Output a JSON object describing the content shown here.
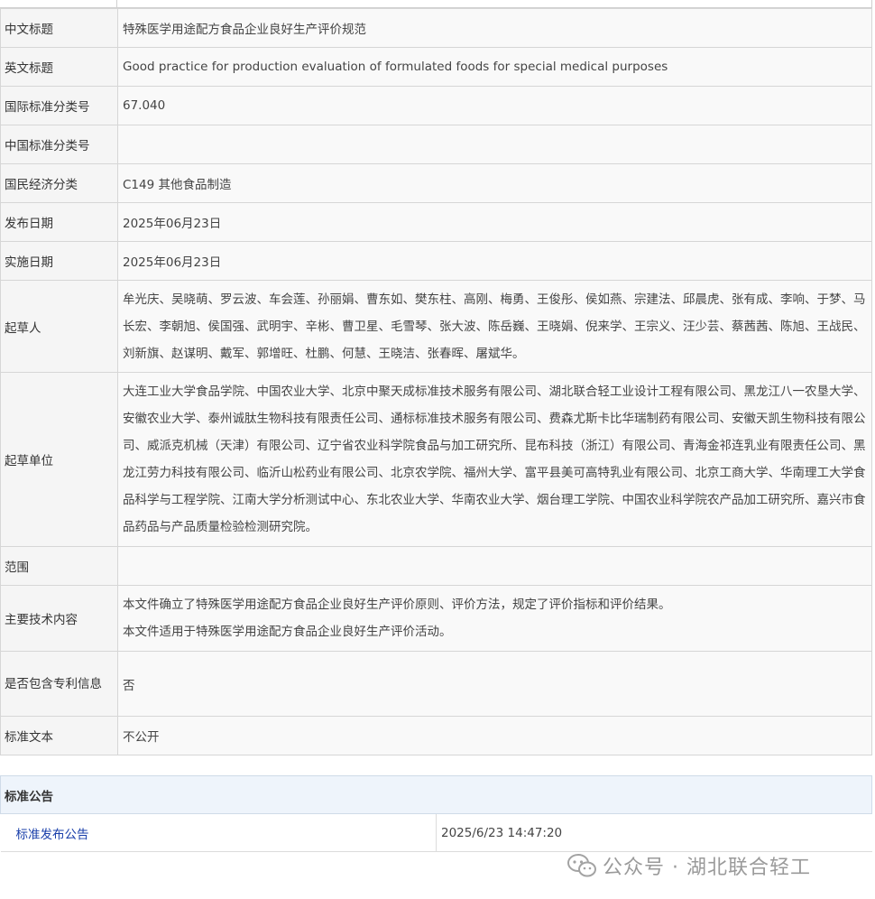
{
  "rows": [
    {
      "label": "中文标题",
      "value": "特殊医学用途配方食品企业良好生产评价规范"
    },
    {
      "label": "英文标题",
      "value": "Good practice for production evaluation of formulated foods for special medical purposes"
    },
    {
      "label": "国际标准分类号",
      "value": "67.040"
    },
    {
      "label": "中国标准分类号",
      "value": ""
    },
    {
      "label": "国民经济分类",
      "value": "C149 其他食品制造"
    },
    {
      "label": "发布日期",
      "value": "2025年06月23日"
    },
    {
      "label": "实施日期",
      "value": "2025年06月23日"
    },
    {
      "label": "起草人",
      "value": "牟光庆、吴晓萌、罗云波、车会莲、孙丽娟、曹东如、樊东柱、高刚、梅勇、王俊彤、侯如燕、宗建法、邱晨虎、张有成、李响、于梦、马长宏、李朝旭、侯国强、武明宇、辛彬、曹卫星、毛雪琴、张大波、陈岳巍、王晓娟、倪来学、王宗义、汪少芸、蔡茜茜、陈旭、王战民、刘新旗、赵谋明、戴军、郭增旺、杜鹏、何慧、王晓洁、张春晖、屠斌华。"
    },
    {
      "label": "起草单位",
      "value": "大连工业大学食品学院、中国农业大学、北京中聚天成标准技术服务有限公司、湖北联合轻工业设计工程有限公司、黑龙江八一农垦大学、安徽农业大学、泰州诚肽生物科技有限责任公司、通标标准技术服务有限公司、费森尤斯卡比华瑞制药有限公司、安徽天凯生物科技有限公司、威派克机械（天津）有限公司、辽宁省农业科学院食品与加工研究所、昆布科技（浙江）有限公司、青海金祁连乳业有限责任公司、黑龙江劳力科技有限公司、临沂山松药业有限公司、北京农学院、福州大学、富平县美可高特乳业有限公司、北京工商大学、华南理工大学食品科学与工程学院、江南大学分析测试中心、东北农业大学、华南农业大学、烟台理工学院、中国农业科学院农产品加工研究所、嘉兴市食品药品与产品质量检验检测研究院。"
    },
    {
      "label": "范围",
      "value": ""
    },
    {
      "label": "主要技术内容",
      "lines": [
        "本文件确立了特殊医学用途配方食品企业良好生产评价原则、评价方法，规定了评价指标和评价结果。",
        "本文件适用于特殊医学用途配方食品企业良好生产评价活动。"
      ]
    },
    {
      "label": "是否包含专利信息",
      "value": "否"
    },
    {
      "label": "标准文本",
      "value": "不公开"
    }
  ],
  "notice": {
    "title": "标准公告",
    "item_label": "标准发布公告",
    "item_time": "2025/6/23 14:47:20"
  },
  "watermark": {
    "text": "公众号 · 湖北联合轻工",
    "icon": "wechat-icon"
  }
}
